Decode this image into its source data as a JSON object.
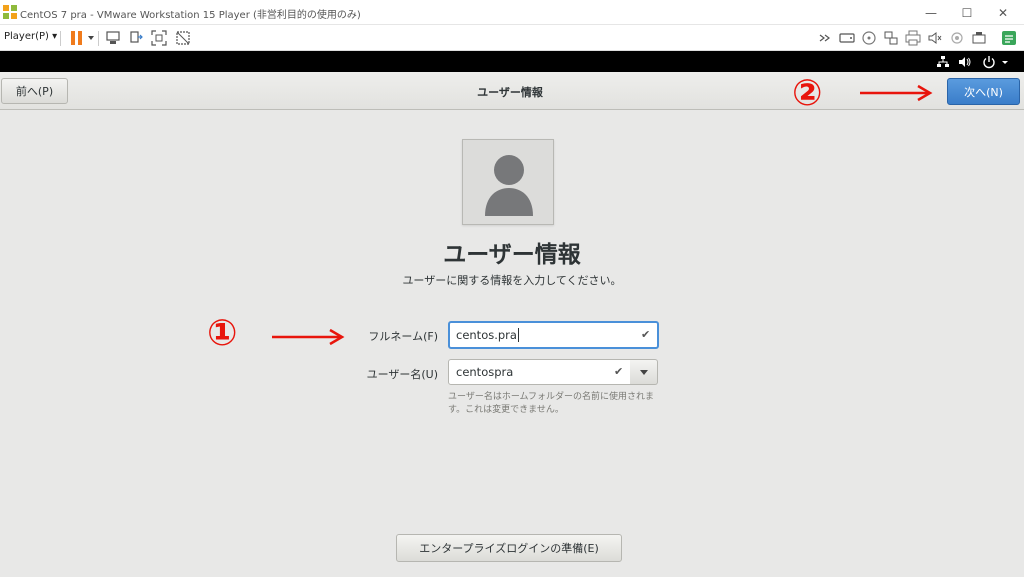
{
  "window": {
    "title": "CentOS 7 pra - VMware Workstation 15 Player (非営利目的の使用のみ)",
    "controls": [
      "—",
      "☐",
      "✕"
    ]
  },
  "toolbar": {
    "player_menu": "Player(P) ▾"
  },
  "header": {
    "prev_button": "前へ(P)",
    "title": "ユーザー情報",
    "next_button": "次へ(N)"
  },
  "main": {
    "title": "ユーザー情報",
    "subtitle": "ユーザーに関する情報を入力してください。",
    "fullname_label": "フルネーム(F)",
    "fullname_value": "centos.pra",
    "username_label": "ユーザー名(U)",
    "username_value": "centospra",
    "username_hint": "ユーザー名はホームフォルダーの名前に使用されます。これは変更できません。",
    "enterprise_button": "エンタープライズログインの準備(E)"
  },
  "annotations": {
    "marker_1": "①",
    "marker_2": "②",
    "color": "#e8150c"
  },
  "colors": {
    "accent": "#4a90d9",
    "next_button": "#3a7dc9",
    "pause_icon": "#f07b1c"
  }
}
